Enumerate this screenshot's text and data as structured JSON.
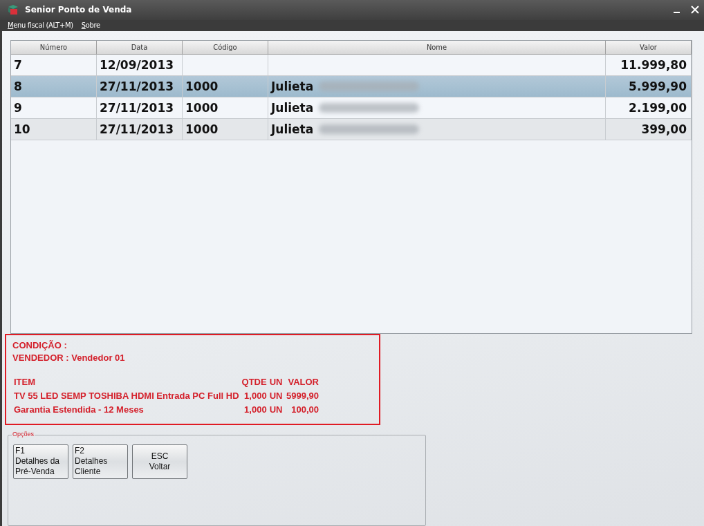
{
  "window": {
    "title": "Senior Ponto de Venda"
  },
  "menu": [
    {
      "label": "Menu fiscal (ALT+M)"
    },
    {
      "label": "Sobre"
    }
  ],
  "table": {
    "columns": [
      "Número",
      "Data",
      "Código",
      "Nome",
      "Valor"
    ],
    "rows": [
      {
        "numero": "7",
        "data": "12/09/2013",
        "codigo": "",
        "nome": "",
        "redacted": false,
        "valor": "11.999,80",
        "selected": false
      },
      {
        "numero": "8",
        "data": "27/11/2013",
        "codigo": "1000",
        "nome": "Julieta",
        "redacted": true,
        "valor": "5.999,90",
        "selected": true
      },
      {
        "numero": "9",
        "data": "27/11/2013",
        "codigo": "1000",
        "nome": "Julieta",
        "redacted": true,
        "valor": "2.199,00",
        "selected": false
      },
      {
        "numero": "10",
        "data": "27/11/2013",
        "codigo": "1000",
        "nome": "Julieta",
        "redacted": true,
        "valor": "399,00",
        "selected": false
      }
    ]
  },
  "info": {
    "condicao": "CONDIÇÃO :",
    "vendedor": "VENDEDOR : Vendedor 01",
    "header": {
      "item": "ITEM",
      "qtde": "QTDE",
      "un": "UN",
      "valor": "VALOR"
    },
    "items": [
      {
        "item": "TV 55 LED SEMP TOSHIBA HDMI Entrada PC Full HD",
        "qtde": "1,000",
        "un": "UN",
        "valor": "5999,90"
      },
      {
        "item": "Garantia Estendida - 12 Meses",
        "qtde": "1,000",
        "un": "UN",
        "valor": "100,00"
      }
    ]
  },
  "options": {
    "legend": "Opções",
    "buttons": [
      {
        "lines": [
          "F1",
          "Detalhes da",
          "Pré-Venda"
        ],
        "centered": false
      },
      {
        "lines": [
          "F2",
          "Detalhes",
          "Cliente"
        ],
        "centered": false
      },
      {
        "lines": [
          "ESC",
          "Voltar"
        ],
        "centered": true
      }
    ]
  }
}
